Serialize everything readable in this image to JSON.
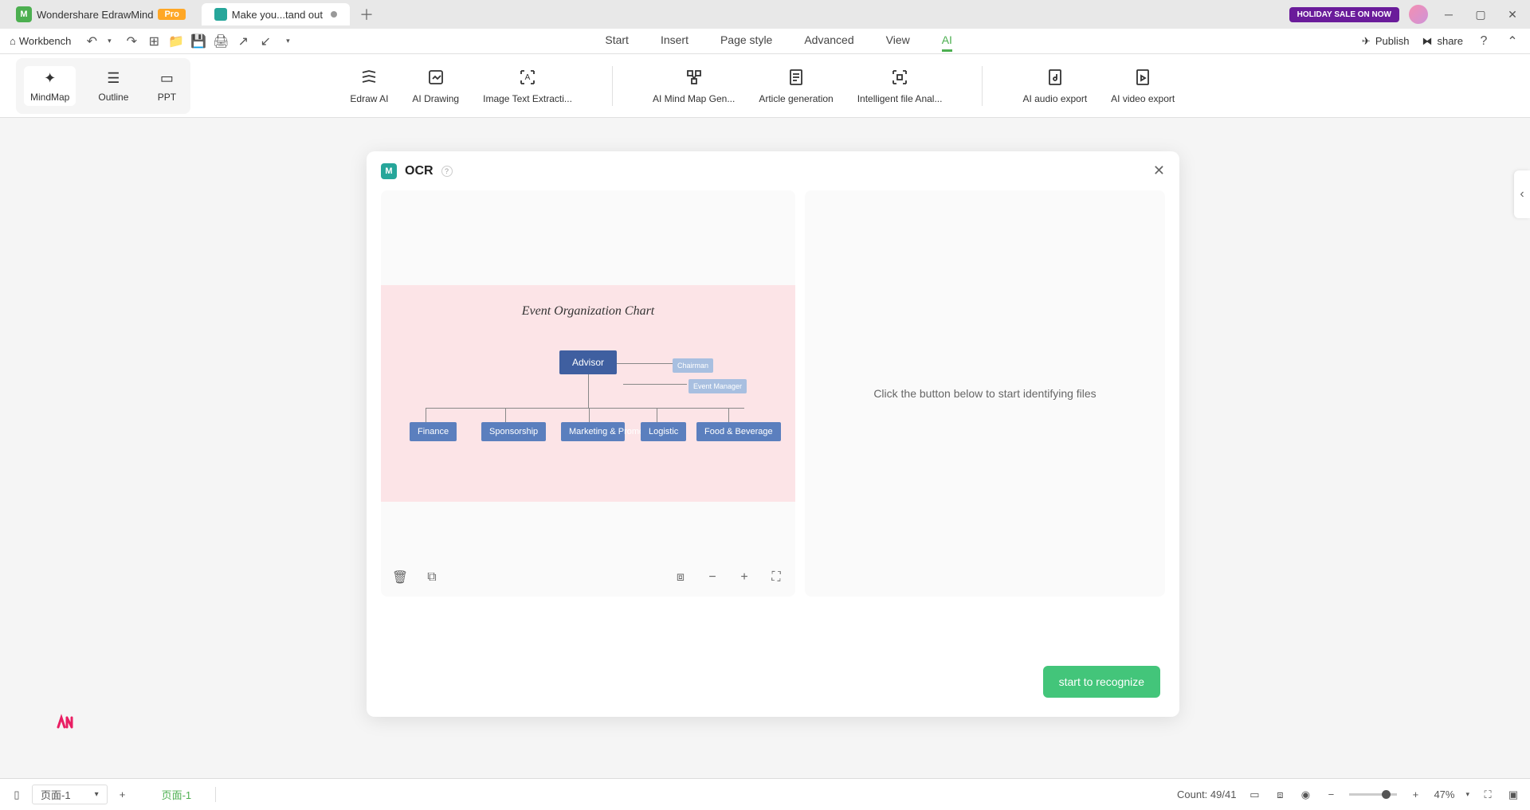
{
  "titlebar": {
    "app_name": "Wondershare EdrawMind",
    "pro_label": "Pro",
    "doc_title": "Make you...tand out",
    "holiday_label": "HOLIDAY SALE ON NOW"
  },
  "toolbar": {
    "workbench_label": "Workbench",
    "menu": {
      "start": "Start",
      "insert": "Insert",
      "page_style": "Page style",
      "advanced": "Advanced",
      "view": "View",
      "ai": "AI"
    },
    "publish_label": "Publish",
    "share_label": "share"
  },
  "ribbon": {
    "views": {
      "mindmap": "MindMap",
      "outline": "Outline",
      "ppt": "PPT"
    },
    "ai_tools": {
      "edraw_ai": "Edraw AI",
      "ai_drawing": "AI Drawing",
      "image_text": "Image Text Extracti...",
      "mindmap_gen": "AI Mind Map Gen...",
      "article_gen": "Article generation",
      "file_anal": "Intelligent file Anal...",
      "audio_export": "AI audio export",
      "video_export": "AI video export"
    }
  },
  "ocr": {
    "title": "OCR",
    "placeholder": "Click the button below to start identifying files",
    "recognize_button": "start to recognize",
    "chart": {
      "title": "Event Organization Chart",
      "advisor": "Advisor",
      "chairman": "Chairman",
      "event_manager": "Event Manager",
      "finance": "Finance",
      "sponsorship": "Sponsorship",
      "marketing": "Marketing & Promotion",
      "logistic": "Logistic",
      "food": "Food & Beverage"
    }
  },
  "statusbar": {
    "page_label": "页面-1",
    "page_tab": "页面-1",
    "count_label": "Count: 49/41",
    "zoom_label": "47%"
  }
}
